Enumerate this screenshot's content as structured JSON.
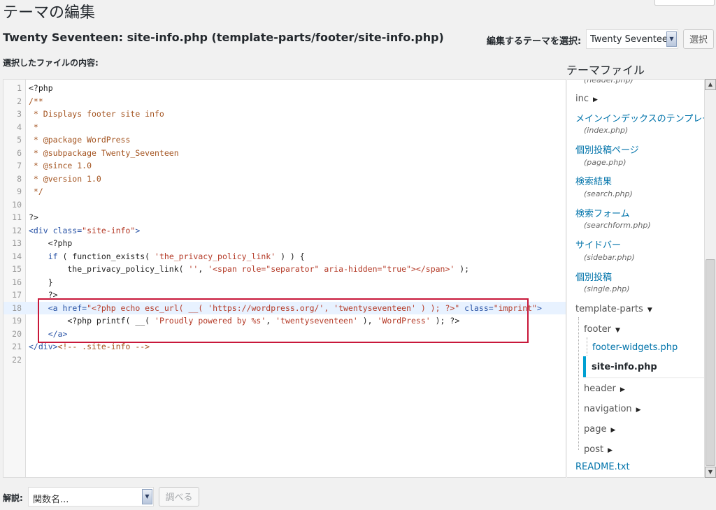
{
  "page": {
    "title": "テーマの編集"
  },
  "file_heading": "Twenty Seventeen: site-info.php (template-parts/footer/site-info.php)",
  "theme_select": {
    "label": "編集するテーマを選択:",
    "value": "Twenty Seventeen",
    "button": "選択"
  },
  "editor": {
    "content_label": "選択したファイルの内容:",
    "lines": [
      {
        "n": "1",
        "tokens": [
          {
            "t": "<?php",
            "c": "plain"
          }
        ]
      },
      {
        "n": "2",
        "tokens": [
          {
            "t": "/**",
            "c": "comment"
          }
        ]
      },
      {
        "n": "3",
        "tokens": [
          {
            "t": " * Displays footer site info",
            "c": "comment"
          }
        ]
      },
      {
        "n": "4",
        "tokens": [
          {
            "t": " *",
            "c": "comment"
          }
        ]
      },
      {
        "n": "5",
        "tokens": [
          {
            "t": " * @package WordPress",
            "c": "comment"
          }
        ]
      },
      {
        "n": "6",
        "tokens": [
          {
            "t": " * @subpackage Twenty_Seventeen",
            "c": "comment"
          }
        ]
      },
      {
        "n": "7",
        "tokens": [
          {
            "t": " * @since 1.0",
            "c": "comment"
          }
        ]
      },
      {
        "n": "8",
        "tokens": [
          {
            "t": " * @version 1.0",
            "c": "comment"
          }
        ]
      },
      {
        "n": "9",
        "tokens": [
          {
            "t": " */",
            "c": "comment"
          }
        ]
      },
      {
        "n": "10",
        "tokens": []
      },
      {
        "n": "11",
        "tokens": [
          {
            "t": "?>",
            "c": "plain"
          }
        ]
      },
      {
        "n": "12",
        "tokens": [
          {
            "t": "<div ",
            "c": "tag"
          },
          {
            "t": "class=",
            "c": "tag"
          },
          {
            "t": "\"site-info\"",
            "c": "str"
          },
          {
            "t": ">",
            "c": "tag"
          }
        ]
      },
      {
        "n": "13",
        "tokens": [
          {
            "t": "    <?php",
            "c": "plain"
          }
        ]
      },
      {
        "n": "14",
        "tokens": [
          {
            "t": "    ",
            "c": "plain"
          },
          {
            "t": "if",
            "c": "kw"
          },
          {
            "t": " ( function_exists( ",
            "c": "plain"
          },
          {
            "t": "'the_privacy_policy_link'",
            "c": "str"
          },
          {
            "t": " ) ) {",
            "c": "plain"
          }
        ]
      },
      {
        "n": "15",
        "tokens": [
          {
            "t": "        the_privacy_policy_link( ",
            "c": "plain"
          },
          {
            "t": "''",
            "c": "str"
          },
          {
            "t": ", ",
            "c": "plain"
          },
          {
            "t": "'<span role=\"separator\" aria-hidden=\"true\"></span>'",
            "c": "str"
          },
          {
            "t": " );",
            "c": "plain"
          }
        ]
      },
      {
        "n": "16",
        "tokens": [
          {
            "t": "    }",
            "c": "plain"
          }
        ]
      },
      {
        "n": "17",
        "tokens": [
          {
            "t": "    ?>",
            "c": "plain"
          }
        ]
      },
      {
        "n": "18",
        "active": true,
        "tokens": [
          {
            "t": "    <a ",
            "c": "tag"
          },
          {
            "t": "href=",
            "c": "tag"
          },
          {
            "t": "\"<?php echo esc_url( __( 'https://wordpress.org/', 'twentyseventeen' ) ); ?>\"",
            "c": "str"
          },
          {
            "t": " class=",
            "c": "tag"
          },
          {
            "t": "\"imprint\"",
            "c": "str"
          },
          {
            "t": ">",
            "c": "tag"
          }
        ]
      },
      {
        "n": "19",
        "tokens": [
          {
            "t": "        <?php printf( __( ",
            "c": "plain"
          },
          {
            "t": "'Proudly powered by %s'",
            "c": "str"
          },
          {
            "t": ", ",
            "c": "plain"
          },
          {
            "t": "'twentyseventeen'",
            "c": "str"
          },
          {
            "t": " ), ",
            "c": "plain"
          },
          {
            "t": "'WordPress'",
            "c": "str"
          },
          {
            "t": " ); ?>",
            "c": "plain"
          }
        ]
      },
      {
        "n": "20",
        "tokens": [
          {
            "t": "    </a>",
            "c": "tag"
          }
        ]
      },
      {
        "n": "21",
        "tokens": [
          {
            "t": "</div>",
            "c": "tag"
          },
          {
            "t": "<!-- .site-info -->",
            "c": "comment"
          }
        ]
      },
      {
        "n": "22",
        "tokens": []
      }
    ]
  },
  "theme_files": {
    "title": "テーマファイル",
    "cutoff_filename": "(header.php)",
    "inc": "inc",
    "items": [
      {
        "label": "メインインデックスのテンプレート",
        "file": "(index.php)"
      },
      {
        "label": "個別投稿ページ",
        "file": "(page.php)"
      },
      {
        "label": "検索結果",
        "file": "(search.php)"
      },
      {
        "label": "検索フォーム",
        "file": "(searchform.php)"
      },
      {
        "label": "サイドバー",
        "file": "(sidebar.php)"
      },
      {
        "label": "個別投稿",
        "file": "(single.php)"
      }
    ],
    "template_parts": "template-parts",
    "footer": "footer",
    "footer_widgets": "footer-widgets.php",
    "site_info": "site-info.php",
    "header": "header",
    "navigation": "navigation",
    "page": "page",
    "post": "post",
    "readme": "README.txt"
  },
  "doc": {
    "label": "解説:",
    "select_value": "関数名...",
    "button": "調べる"
  },
  "colors": {
    "link": "#0073aa",
    "highlight_border": "#c8183a",
    "current_accent": "#00a0d2"
  }
}
